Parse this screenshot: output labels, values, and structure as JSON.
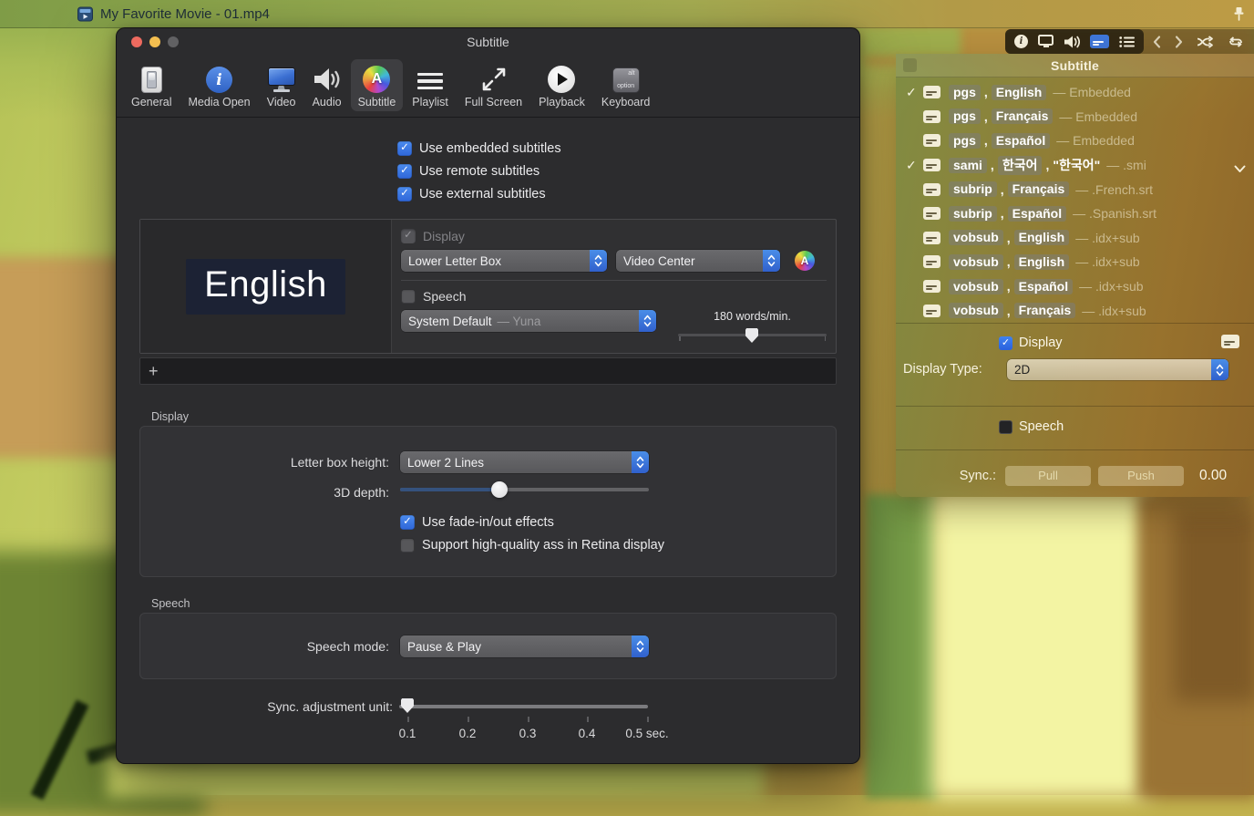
{
  "desktop": {
    "window_title": "My Favorite Movie - 01.mp4"
  },
  "colors": {
    "accent_blue": "#3b7de0",
    "stepper_cap_blue": "#3d76d8",
    "panel_tint_green": "#7c8a42",
    "panel_tint_brown": "#8c6a2c"
  },
  "prefs": {
    "title": "Subtitle",
    "toolbar_items": [
      {
        "label": "General",
        "icon": "switch-icon",
        "selected": false
      },
      {
        "label": "Media Open",
        "icon": "info-circle-icon",
        "selected": false
      },
      {
        "label": "Video",
        "icon": "monitor-icon",
        "selected": false
      },
      {
        "label": "Audio",
        "icon": "speaker-icon",
        "selected": false
      },
      {
        "label": "Subtitle",
        "icon": "rainbow-a-icon",
        "selected": true
      },
      {
        "label": "Playlist",
        "icon": "list-icon",
        "selected": false
      },
      {
        "label": "Full Screen",
        "icon": "fullscreen-arrows-icon",
        "selected": false
      },
      {
        "label": "Playback",
        "icon": "play-circle-icon",
        "selected": false
      },
      {
        "label": "Keyboard",
        "icon": "option-key-icon",
        "selected": false
      }
    ],
    "source_options": [
      {
        "label": "Use embedded subtitles",
        "checked": true
      },
      {
        "label": "Use remote subtitles",
        "checked": true
      },
      {
        "label": "Use external subtitles",
        "checked": true
      }
    ],
    "track_editor": {
      "preview_text": "English",
      "display_label": "Display",
      "display_checked": true,
      "position_value": "Lower Letter Box",
      "anchor_value": "Video Center",
      "speech_label": "Speech",
      "speech_checked": false,
      "voice_value": "System Default",
      "voice_detail": "— Yuna",
      "rate_label": "180 words/min.",
      "add_label": "+"
    },
    "display_section": {
      "title": "Display",
      "letterbox_label": "Letter box height:",
      "letterbox_value": "Lower 2 Lines",
      "depth_label": "3D depth:",
      "depth_percent": 40,
      "options": [
        {
          "label": "Use fade-in/out effects",
          "checked": true
        },
        {
          "label": "Support high-quality ass in Retina display",
          "checked": false
        }
      ]
    },
    "speech_section": {
      "title": "Speech",
      "mode_label": "Speech mode:",
      "mode_value": "Pause & Play"
    },
    "sync_section": {
      "label": "Sync. adjustment unit:",
      "tick_labels": [
        "0.1",
        "0.2",
        "0.3",
        "0.4",
        "0.5 sec."
      ]
    }
  },
  "panel": {
    "title": "Subtitle",
    "control_icons": [
      "info-icon",
      "monitor-icon",
      "speaker-icon",
      "subtitle-icon",
      "list-icon"
    ],
    "nav_icons": [
      "chevron-left-icon",
      "chevron-right-icon",
      "shuffle-icon",
      "repeat-icon"
    ],
    "tracks": [
      {
        "checked": true,
        "format": "pgs",
        "lang": "English",
        "name": "",
        "source": "— Embedded",
        "expander": false
      },
      {
        "checked": false,
        "format": "pgs",
        "lang": "Français",
        "name": "",
        "source": "— Embedded",
        "expander": false
      },
      {
        "checked": false,
        "format": "pgs",
        "lang": "Español",
        "name": "",
        "source": "— Embedded",
        "expander": false
      },
      {
        "checked": true,
        "format": "sami",
        "lang": "한국어",
        "name": "\"한국어\"",
        "source": "— .smi",
        "expander": true
      },
      {
        "checked": false,
        "format": "subrip",
        "lang": "Français",
        "name": "",
        "source": "— .French.srt",
        "expander": false
      },
      {
        "checked": false,
        "format": "subrip",
        "lang": "Español",
        "name": "",
        "source": "— .Spanish.srt",
        "expander": false
      },
      {
        "checked": false,
        "format": "vobsub",
        "lang": "English",
        "name": "",
        "source": "— .idx+sub",
        "expander": false
      },
      {
        "checked": false,
        "format": "vobsub",
        "lang": "English",
        "name": "",
        "source": "— .idx+sub",
        "expander": false
      },
      {
        "checked": false,
        "format": "vobsub",
        "lang": "Español",
        "name": "",
        "source": "— .idx+sub",
        "expander": false
      },
      {
        "checked": false,
        "format": "vobsub",
        "lang": "Français",
        "name": "",
        "source": "— .idx+sub",
        "expander": false
      }
    ],
    "display_label": "Display",
    "display_checked": true,
    "display_type_label": "Display Type:",
    "display_type_value": "2D",
    "speech_label": "Speech",
    "speech_checked": false,
    "sync_label": "Sync.:",
    "pull_label": "Pull",
    "push_label": "Push",
    "sync_value": "0.00"
  }
}
